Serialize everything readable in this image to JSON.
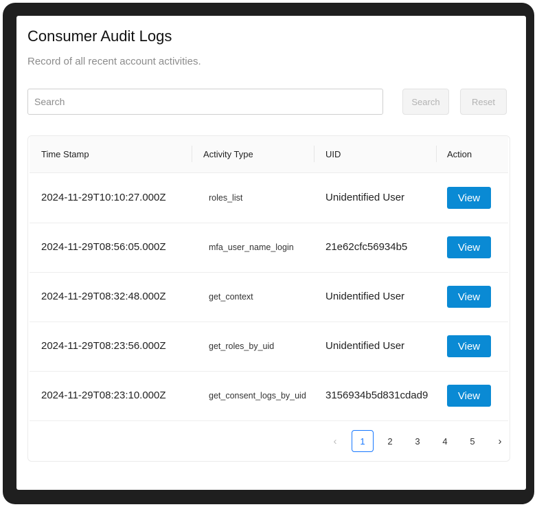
{
  "header": {
    "title": "Consumer Audit Logs",
    "subtitle": "Record of all recent account activities."
  },
  "search": {
    "placeholder": "Search",
    "search_label": "Search",
    "reset_label": "Reset"
  },
  "table": {
    "columns": [
      "Time Stamp",
      "Activity Type",
      "UID",
      "Action"
    ],
    "rows": [
      {
        "timestamp": "2024-11-29T10:10:27.000Z",
        "activity": "roles_list",
        "uid": "Unidentified User",
        "action": "View"
      },
      {
        "timestamp": "2024-11-29T08:56:05.000Z",
        "activity": "mfa_user_name_login",
        "uid": "21e62cfc56934b5",
        "action": "View"
      },
      {
        "timestamp": "2024-11-29T08:32:48.000Z",
        "activity": "get_context",
        "uid": "Unidentified User",
        "action": "View"
      },
      {
        "timestamp": "2024-11-29T08:23:56.000Z",
        "activity": "get_roles_by_uid",
        "uid": "Unidentified User",
        "action": "View"
      },
      {
        "timestamp": "2024-11-29T08:23:10.000Z",
        "activity": "get_consent_logs_by_uid",
        "uid": "3156934b5d831cdad9",
        "action": "View"
      }
    ]
  },
  "pagination": {
    "prev_icon": "chevron-left-icon",
    "next_icon": "chevron-right-icon",
    "pages": [
      "1",
      "2",
      "3",
      "4",
      "5"
    ],
    "current": "1",
    "prev_glyph": "‹",
    "next_glyph": "›"
  },
  "colors": {
    "accent": "#0a8ad4",
    "active_page": "#1677ff",
    "frame": "#1f1f1f"
  }
}
